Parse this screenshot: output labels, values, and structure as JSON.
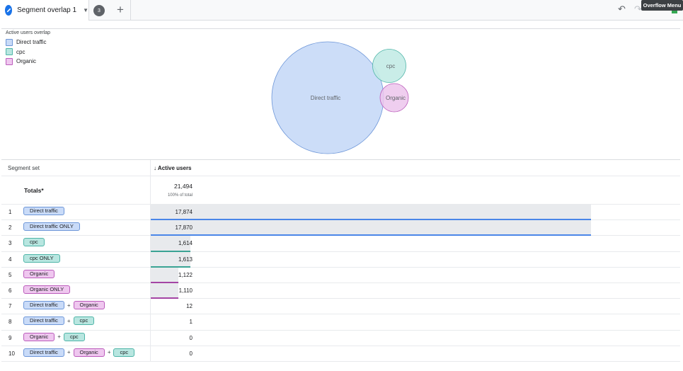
{
  "header": {
    "tab_label": "Segment overlap 1",
    "tab_count": "3",
    "add_tab_symbol": "+",
    "overflow_tooltip": "Overflow Menu"
  },
  "chart_data": {
    "type": "venn",
    "title": "Active users overlap",
    "legend_placement": "top-left",
    "sets": [
      {
        "name": "Direct traffic",
        "value": 17874,
        "color": "#c9dbf8",
        "stroke": "#6d96d8"
      },
      {
        "name": "cpc",
        "value": 1614,
        "color": "#c3ebe6",
        "stroke": "#4fb5a8"
      },
      {
        "name": "Organic",
        "value": 1122,
        "color": "#ecc6ec",
        "stroke": "#bb5cbb"
      }
    ],
    "labels": [
      "Direct traffic",
      "cpc",
      "Organic"
    ]
  },
  "table": {
    "header_segment": "Segment set",
    "header_metric": "↓ Active users",
    "totals_label": "Totals*",
    "totals_value": "21,494",
    "totals_sub": "100% of total",
    "max_value": 21494,
    "rows": [
      {
        "num": "1",
        "segments": [
          "Direct traffic"
        ],
        "value": "17,874",
        "raw": 17874,
        "line": "#4a86e8"
      },
      {
        "num": "2",
        "segments": [
          "Direct traffic ONLY"
        ],
        "value": "17,870",
        "raw": 17870,
        "line": "#4a86e8"
      },
      {
        "num": "3",
        "segments": [
          "cpc"
        ],
        "value": "1,614",
        "raw": 1614,
        "line": "#3aa394"
      },
      {
        "num": "4",
        "segments": [
          "cpc ONLY"
        ],
        "value": "1,613",
        "raw": 1613,
        "line": "#3aa394"
      },
      {
        "num": "5",
        "segments": [
          "Organic"
        ],
        "value": "1,122",
        "raw": 1122,
        "line": "#a445a4"
      },
      {
        "num": "6",
        "segments": [
          "Organic ONLY"
        ],
        "value": "1,110",
        "raw": 1110,
        "line": "#a445a4"
      },
      {
        "num": "7",
        "segments": [
          "Direct traffic",
          "Organic"
        ],
        "value": "12",
        "raw": 12,
        "line": ""
      },
      {
        "num": "8",
        "segments": [
          "Direct traffic",
          "cpc"
        ],
        "value": "1",
        "raw": 1,
        "line": ""
      },
      {
        "num": "9",
        "segments": [
          "Organic",
          "cpc"
        ],
        "value": "0",
        "raw": 0,
        "line": ""
      },
      {
        "num": "10",
        "segments": [
          "Direct traffic",
          "Organic",
          "cpc"
        ],
        "value": "0",
        "raw": 0,
        "line": ""
      }
    ]
  }
}
